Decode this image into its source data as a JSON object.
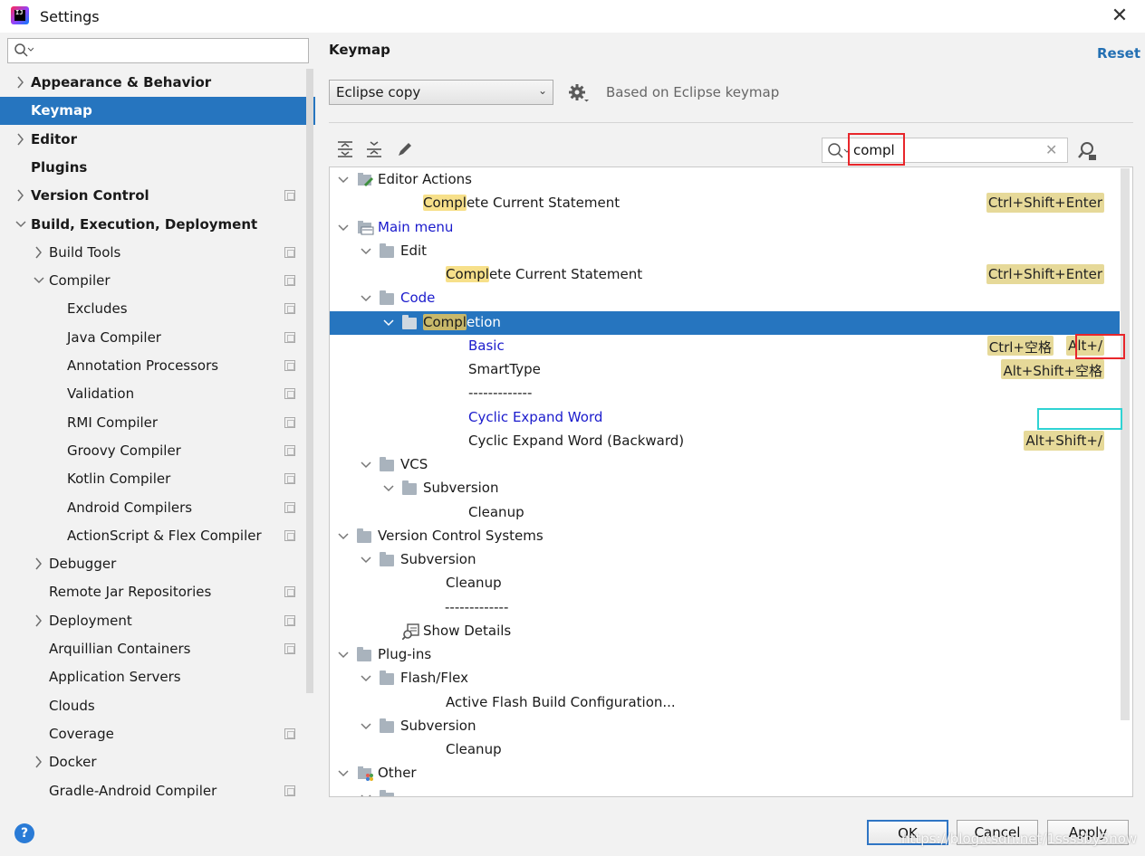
{
  "window": {
    "title": "Settings",
    "close_glyph": "✕"
  },
  "left_search": {
    "value": "",
    "icon": "search-icon"
  },
  "left_nav": [
    {
      "label": "Appearance & Behavior",
      "level": 0,
      "chevron": "right",
      "bold": true,
      "copy": false
    },
    {
      "label": "Keymap",
      "level": 0,
      "chevron": "none",
      "bold": true,
      "selected": true,
      "copy": false
    },
    {
      "label": "Editor",
      "level": 0,
      "chevron": "right",
      "bold": true,
      "copy": false
    },
    {
      "label": "Plugins",
      "level": 0,
      "chevron": "none",
      "bold": true,
      "copy": false
    },
    {
      "label": "Version Control",
      "level": 0,
      "chevron": "right",
      "bold": true,
      "copy": true
    },
    {
      "label": "Build, Execution, Deployment",
      "level": 0,
      "chevron": "down",
      "bold": true,
      "copy": false
    },
    {
      "label": "Build Tools",
      "level": 1,
      "chevron": "right",
      "copy": true
    },
    {
      "label": "Compiler",
      "level": 1,
      "chevron": "down",
      "copy": true
    },
    {
      "label": "Excludes",
      "level": 2,
      "chevron": "none",
      "copy": true
    },
    {
      "label": "Java Compiler",
      "level": 2,
      "chevron": "none",
      "copy": true
    },
    {
      "label": "Annotation Processors",
      "level": 2,
      "chevron": "none",
      "copy": true
    },
    {
      "label": "Validation",
      "level": 2,
      "chevron": "none",
      "copy": true
    },
    {
      "label": "RMI Compiler",
      "level": 2,
      "chevron": "none",
      "copy": true
    },
    {
      "label": "Groovy Compiler",
      "level": 2,
      "chevron": "none",
      "copy": true
    },
    {
      "label": "Kotlin Compiler",
      "level": 2,
      "chevron": "none",
      "copy": true
    },
    {
      "label": "Android Compilers",
      "level": 2,
      "chevron": "none",
      "copy": true
    },
    {
      "label": "ActionScript & Flex Compiler",
      "level": 2,
      "chevron": "none",
      "copy": true
    },
    {
      "label": "Debugger",
      "level": 1,
      "chevron": "right",
      "copy": false
    },
    {
      "label": "Remote Jar Repositories",
      "level": 1,
      "chevron": "none",
      "copy": true
    },
    {
      "label": "Deployment",
      "level": 1,
      "chevron": "right",
      "copy": true
    },
    {
      "label": "Arquillian Containers",
      "level": 1,
      "chevron": "none",
      "copy": true
    },
    {
      "label": "Application Servers",
      "level": 1,
      "chevron": "none",
      "copy": false
    },
    {
      "label": "Clouds",
      "level": 1,
      "chevron": "none",
      "copy": false
    },
    {
      "label": "Coverage",
      "level": 1,
      "chevron": "none",
      "copy": true
    },
    {
      "label": "Docker",
      "level": 1,
      "chevron": "right",
      "copy": false
    },
    {
      "label": "Gradle-Android Compiler",
      "level": 1,
      "chevron": "none",
      "copy": true
    }
  ],
  "panel": {
    "title": "Keymap",
    "reset": "Reset",
    "keymap_selected": "Eclipse copy",
    "based_on": "Based on Eclipse keymap",
    "filter_value": "compl"
  },
  "tree": [
    {
      "level": 0,
      "chevron": "down",
      "icon": "editor-actions-icon",
      "parts": [
        {
          "t": "Editor Actions"
        }
      ]
    },
    {
      "level": 1,
      "chevron": "none",
      "icon": "none",
      "parts": [
        {
          "t": "Compl",
          "hl": true
        },
        {
          "t": "ete Current Statement"
        }
      ],
      "shortcuts": [
        "Ctrl+Shift+Enter"
      ]
    },
    {
      "level": 0,
      "chevron": "down",
      "icon": "main-menu-icon",
      "blue": true,
      "parts": [
        {
          "t": "Main menu"
        }
      ]
    },
    {
      "level": 1,
      "chevron": "down",
      "icon": "folder",
      "parts": [
        {
          "t": "Edit"
        }
      ]
    },
    {
      "level": 2,
      "chevron": "none",
      "icon": "none",
      "parts": [
        {
          "t": "Compl",
          "hl": true
        },
        {
          "t": "ete Current Statement"
        }
      ],
      "shortcuts": [
        "Ctrl+Shift+Enter"
      ]
    },
    {
      "level": 1,
      "chevron": "down",
      "icon": "folder",
      "blue": true,
      "parts": [
        {
          "t": "Code"
        }
      ]
    },
    {
      "level": 2,
      "chevron": "down",
      "icon": "folder",
      "selected": true,
      "parts": [
        {
          "t": "Compl",
          "hl": true
        },
        {
          "t": "etion"
        }
      ]
    },
    {
      "level": 3,
      "chevron": "none",
      "icon": "none",
      "blue": true,
      "parts": [
        {
          "t": "Basic"
        }
      ],
      "shortcuts": [
        "Ctrl+空格",
        "Alt+/"
      ]
    },
    {
      "level": 3,
      "chevron": "none",
      "icon": "none",
      "parts": [
        {
          "t": "SmartType"
        }
      ],
      "shortcuts": [
        "Alt+Shift+空格"
      ]
    },
    {
      "level": 3,
      "chevron": "none",
      "icon": "none",
      "parts": [
        {
          "t": "-------------"
        }
      ]
    },
    {
      "level": 3,
      "chevron": "none",
      "icon": "none",
      "blue": true,
      "parts": [
        {
          "t": "Cyclic Expand Word"
        }
      ]
    },
    {
      "level": 3,
      "chevron": "none",
      "icon": "none",
      "parts": [
        {
          "t": "Cyclic Expand Word (Backward)"
        }
      ],
      "shortcuts": [
        "Alt+Shift+/"
      ]
    },
    {
      "level": 1,
      "chevron": "down",
      "icon": "folder",
      "parts": [
        {
          "t": "VCS"
        }
      ]
    },
    {
      "level": 2,
      "chevron": "down",
      "icon": "folder",
      "parts": [
        {
          "t": "Subversion"
        }
      ]
    },
    {
      "level": 3,
      "chevron": "none",
      "icon": "none",
      "parts": [
        {
          "t": "Cleanup"
        }
      ]
    },
    {
      "level": 0,
      "chevron": "down",
      "icon": "folder",
      "parts": [
        {
          "t": "Version Control Systems"
        }
      ]
    },
    {
      "level": 1,
      "chevron": "down",
      "icon": "folder",
      "parts": [
        {
          "t": "Subversion"
        }
      ]
    },
    {
      "level": 2,
      "chevron": "none",
      "icon": "none",
      "parts": [
        {
          "t": "Cleanup"
        }
      ]
    },
    {
      "level": 2,
      "chevron": "none",
      "icon": "none",
      "parts": [
        {
          "t": "-------------"
        }
      ],
      "x_shift": -1
    },
    {
      "level": 1,
      "chevron": "none",
      "icon": "show-details-icon",
      "parts": [
        {
          "t": "Show Details"
        }
      ]
    },
    {
      "level": 0,
      "chevron": "down",
      "icon": "folder",
      "parts": [
        {
          "t": "Plug-ins"
        }
      ]
    },
    {
      "level": 1,
      "chevron": "down",
      "icon": "folder",
      "parts": [
        {
          "t": "Flash/Flex"
        }
      ]
    },
    {
      "level": 2,
      "chevron": "none",
      "icon": "none",
      "parts": [
        {
          "t": "Active Flash Build Configuration..."
        }
      ]
    },
    {
      "level": 1,
      "chevron": "down",
      "icon": "folder",
      "parts": [
        {
          "t": "Subversion"
        }
      ]
    },
    {
      "level": 2,
      "chevron": "none",
      "icon": "none",
      "parts": [
        {
          "t": "Cleanup"
        }
      ]
    },
    {
      "level": 0,
      "chevron": "down",
      "icon": "other-icon",
      "parts": [
        {
          "t": "Other"
        }
      ]
    }
  ],
  "buttons": {
    "ok": "OK",
    "cancel": "Cancel",
    "apply": "Apply",
    "help": "?"
  },
  "watermark": "https://blog.csdn.net/1ssssby5now"
}
